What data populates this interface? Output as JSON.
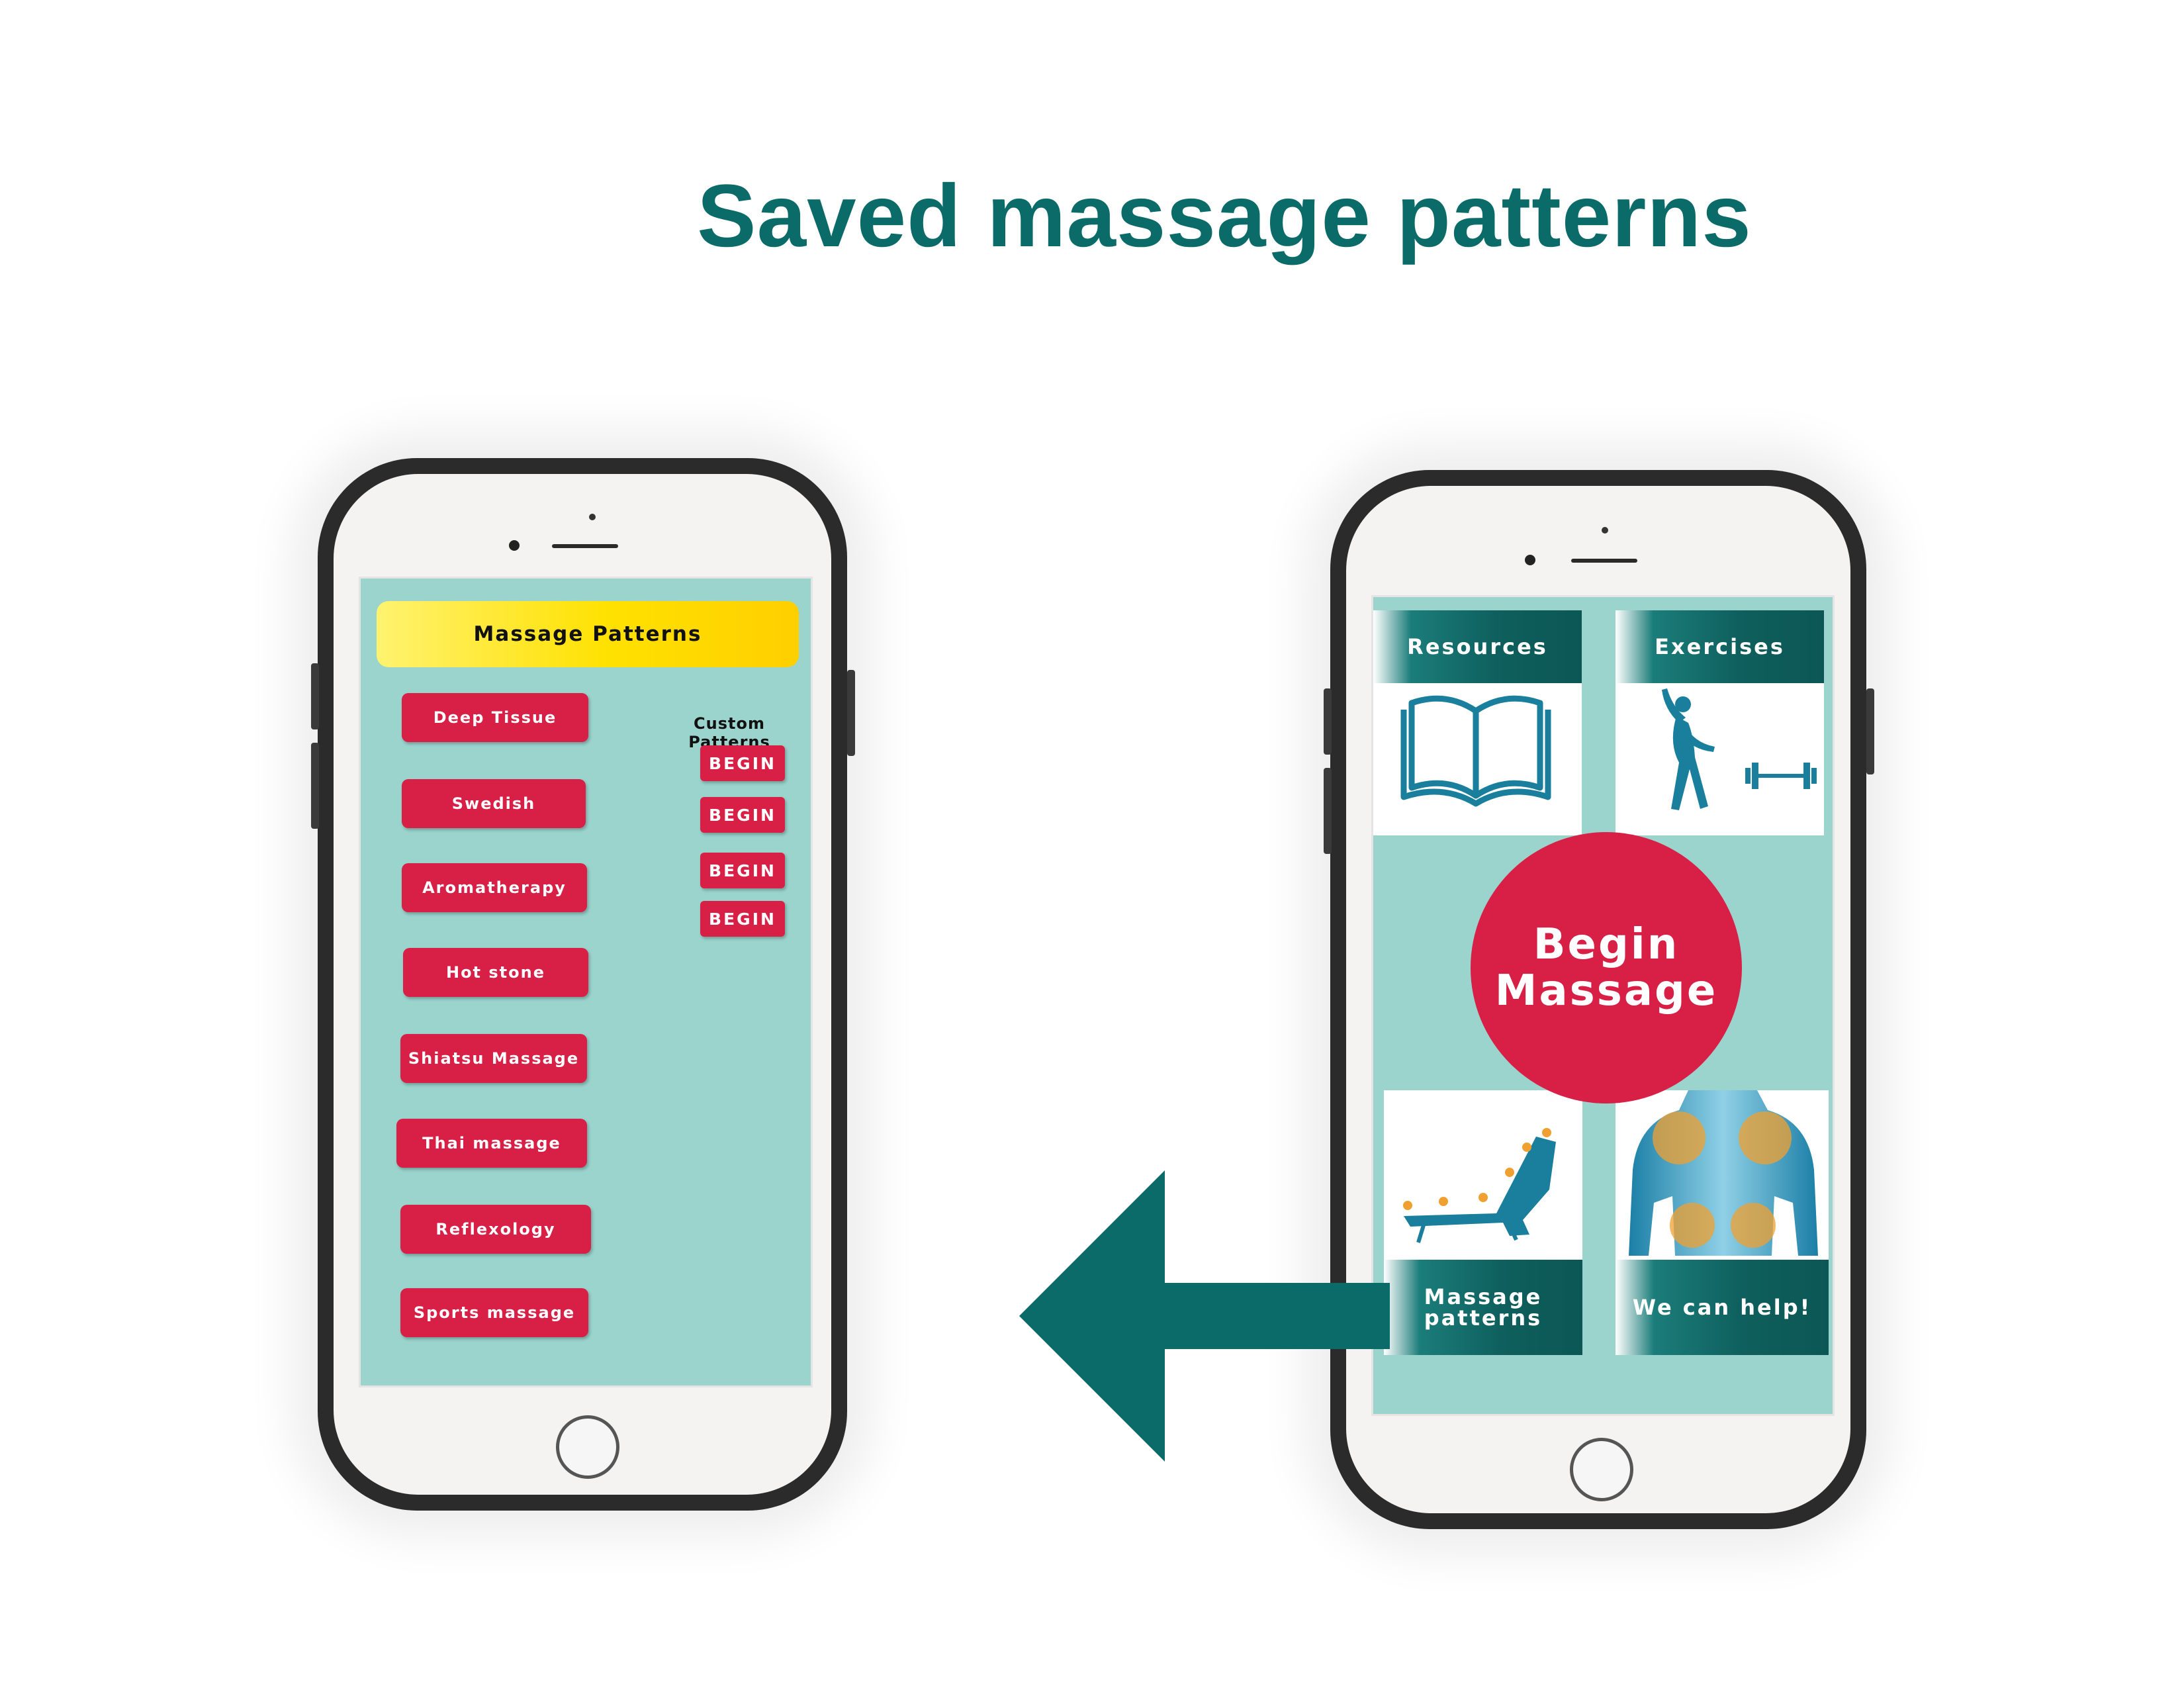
{
  "page": {
    "title": "Saved massage patterns"
  },
  "left_phone": {
    "header": "Massage Patterns",
    "patterns": [
      "Deep Tissue",
      "Swedish",
      "Aromatherapy",
      "Hot stone",
      "Shiatsu Massage",
      "Thai massage",
      "Reflexology",
      "Sports massage"
    ],
    "custom_label": "Custom Patterns",
    "custom_buttons": [
      "BEGIN",
      "BEGIN",
      "BEGIN",
      "BEGIN"
    ]
  },
  "right_phone": {
    "resources_label": "Resources",
    "exercises_label": "Exercises",
    "begin_line1": "Begin",
    "begin_line2": "Massage",
    "massage_patterns_line1": "Massage",
    "massage_patterns_line2": "patterns",
    "help_label": "We can help!"
  },
  "colors": {
    "accent_teal": "#0a6b68",
    "screen_bg": "#9bd3cd",
    "button_red": "#d81f45",
    "header_yellow": "#ffe100",
    "icon_blue": "#1a7f9c"
  },
  "icons": [
    "book-icon",
    "stretching-person-icon",
    "dumbbell-icon",
    "recliner-massage-icon",
    "back-massage-icon",
    "arrow-left-icon"
  ]
}
